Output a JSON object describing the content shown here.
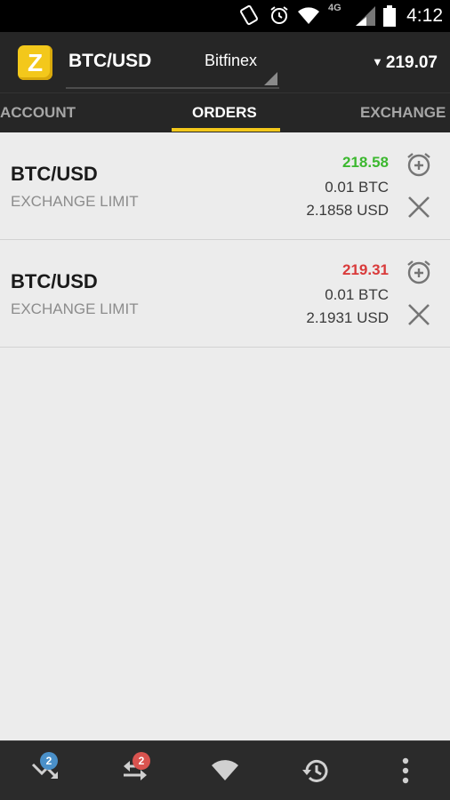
{
  "status_bar": {
    "time": "4:12",
    "network": "4G",
    "icons": [
      "vibrate-icon",
      "alarm-icon",
      "wifi-icon",
      "signal-icon",
      "battery-icon"
    ]
  },
  "app_bar": {
    "logo_letter": "Z",
    "pair": "BTC/USD",
    "exchange": "Bitfinex",
    "last_price": "219.07",
    "price_direction": "down"
  },
  "tabs": [
    {
      "label": "ACCOUNT",
      "active": false
    },
    {
      "label": "ORDERS",
      "active": true
    },
    {
      "label": "EXCHANGE",
      "active": false
    }
  ],
  "orders": [
    {
      "pair": "BTC/USD",
      "type": "EXCHANGE LIMIT",
      "price": "218.58",
      "price_color": "#3cb82f",
      "amount": "0.01 BTC",
      "total": "2.1858 USD"
    },
    {
      "pair": "BTC/USD",
      "type": "EXCHANGE LIMIT",
      "price": "219.31",
      "price_color": "#d93a3a",
      "amount": "0.01 BTC",
      "total": "2.1931 USD"
    }
  ],
  "bottom_nav": {
    "trends_badge": "2",
    "transfers_badge": "2",
    "badge_colors": {
      "trends": "#4a90c9",
      "transfers": "#d9534f"
    },
    "icons": [
      "trending-down-icon",
      "transfer-arrows-icon",
      "wifi-icon",
      "history-icon",
      "more-vert-icon"
    ]
  },
  "colors": {
    "accent": "#f3c81b",
    "bar": "#262626",
    "background": "#ececec"
  }
}
